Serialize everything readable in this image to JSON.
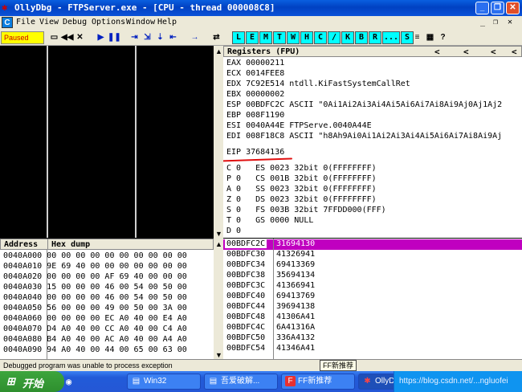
{
  "window": {
    "title": "OllyDbg - FTPServer.exe - [CPU - thread 000008C8]",
    "controls": [
      "_",
      "❐",
      "✕"
    ]
  },
  "menu": [
    "File",
    "View",
    "Debug",
    "Options",
    "Window",
    "Help"
  ],
  "menu_sys": [
    "_",
    "❐",
    "✕"
  ],
  "toolbar": {
    "status": "Paused",
    "buttons": [
      "▭",
      "◀◀",
      "✕",
      "▶",
      "❚❚",
      "⇥",
      "⇲",
      "⇣",
      "⇤",
      "→",
      "⇄"
    ],
    "letters": [
      "L",
      "E",
      "M",
      "T",
      "W",
      "H",
      "C",
      "/",
      "K",
      "B",
      "R",
      "...",
      "S"
    ],
    "right_buttons": [
      "≡",
      "▦",
      "?"
    ]
  },
  "registers": {
    "header": "Registers (FPU)",
    "arrows": [
      "<",
      "<",
      "<",
      "<"
    ],
    "rows": [
      "EAX 00000211",
      "ECX 0014FEE8",
      "EDX 7C92E514 ntdll.KiFastSystemCallRet",
      "EBX 00000002",
      "ESP 00BDFC2C ASCII \"0Ai1Ai2Ai3Ai4Ai5Ai6Ai7Ai8Ai9Aj0Aj1Aj2",
      "EBP 008F1190",
      "ESI 0040A44E FTPServe.0040A44E",
      "EDI 008F18C8 ASCII \"h8Ah9Ai0Ai1Ai2Ai3Ai4Ai5Ai6Ai7Ai8Ai9Aj",
      "",
      "EIP 37684136",
      "",
      "C 0   ES 0023 32bit 0(FFFFFFFF)",
      "P 0   CS 001B 32bit 0(FFFFFFFF)",
      "A 0   SS 0023 32bit 0(FFFFFFFF)",
      "Z 0   DS 0023 32bit 0(FFFFFFFF)",
      "S 0   FS 003B 32bit 7FFDD000(FFF)",
      "T 0   GS 0000 NULL",
      "D 0"
    ]
  },
  "hexdump": {
    "headers": [
      "Address",
      "Hex dump"
    ],
    "rows": [
      "0040A000 00 00 00 00 00 00 00 00 00 00",
      "0040A010 9E 69 40 00 00 00 00 00 00 00",
      "0040A020 00 00 00 00 AF 69 40 00 00 00",
      "0040A030 15 00 00 00 46 00 54 00 50 00",
      "0040A040 00 00 00 00 46 00 54 00 50 00",
      "0040A050 56 00 00 00 49 00 50 00 3A 00",
      "0040A060 00 00 00 00 EC A0 40 00 E4 A0",
      "0040A070 D4 A0 40 00 CC A0 40 00 C4 A0",
      "0040A080 B4 A0 40 00 AC A0 40 00 A4 A0",
      "0040A090 94 A0 40 00 44 00 65 00 63 00"
    ]
  },
  "stack": {
    "rows": [
      {
        "addr": "00BDFC2C",
        "val": "31694130"
      },
      {
        "addr": "00BDFC30",
        "val": "41326941"
      },
      {
        "addr": "00BDFC34",
        "val": "69413369"
      },
      {
        "addr": "00BDFC38",
        "val": "35694134"
      },
      {
        "addr": "00BDFC3C",
        "val": "41366941"
      },
      {
        "addr": "00BDFC40",
        "val": "69413769"
      },
      {
        "addr": "00BDFC44",
        "val": "39694138"
      },
      {
        "addr": "00BDFC48",
        "val": "41306A41"
      },
      {
        "addr": "00BDFC4C",
        "val": "6A41316A"
      },
      {
        "addr": "00BDFC50",
        "val": "336A4132"
      },
      {
        "addr": "00BDFC54",
        "val": "41346A41"
      }
    ]
  },
  "status_text": "Debugged program was unable to process exception",
  "ime_label": "FF新推荐",
  "taskbar": {
    "start": "开始",
    "tasks": [
      "Win32",
      "吾爱破解...",
      "FF新推荐",
      "OllyDbg"
    ],
    "tray_text": "https://blog.csdn.net/...ngluofei"
  },
  "colors": {
    "highlight": "#c000c0",
    "annotation": "#e01010",
    "paused_bg": "#ffff00",
    "letter_btn": "#00ffff"
  }
}
